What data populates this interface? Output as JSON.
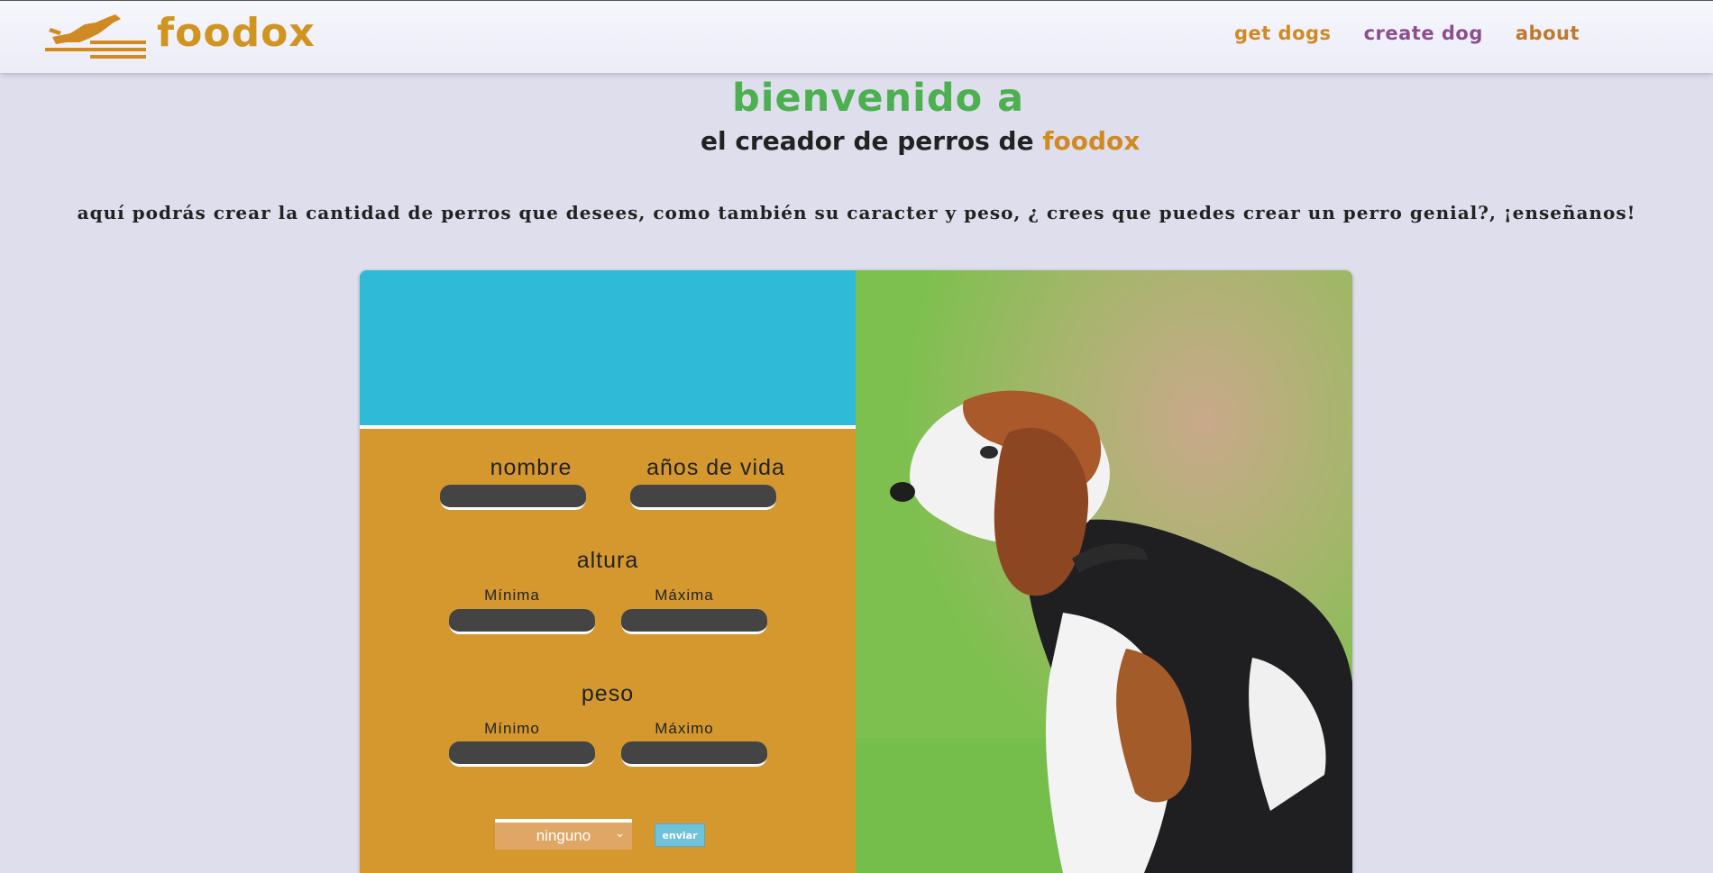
{
  "header": {
    "brand": "foodox",
    "nav": [
      {
        "label": "get dogs",
        "color": "#d08a21"
      },
      {
        "label": "create dog",
        "color": "#8b4f8f"
      },
      {
        "label": "about",
        "color": "#c0782b"
      }
    ]
  },
  "hero": {
    "welcome": "bienvenido a",
    "subtitle": "el creador de perros de",
    "subtitle_brand": "foodox",
    "intro": "aquí podrás crear la cantidad de perros que desees, como también su caracter y peso, ¿ crees que puedes crear un perro genial?, ¡enseñanos!"
  },
  "form": {
    "name_label": "nombre",
    "life_label": "años de vida",
    "height_label": "altura",
    "height_min": "Mínima",
    "height_max": "Máxima",
    "weight_label": "peso",
    "weight_min": "Mínimo",
    "weight_max": "Máximo",
    "temperament_selected": "ninguno",
    "submit_label": "enviar"
  },
  "colors": {
    "accent_orange": "#d4982f",
    "accent_cyan": "#2fbbd7",
    "brand": "#d09421",
    "welcome_green": "#4caf50"
  },
  "icons": {
    "logo": "running-dog-logo",
    "select_chevron": "chevron-down-icon"
  }
}
